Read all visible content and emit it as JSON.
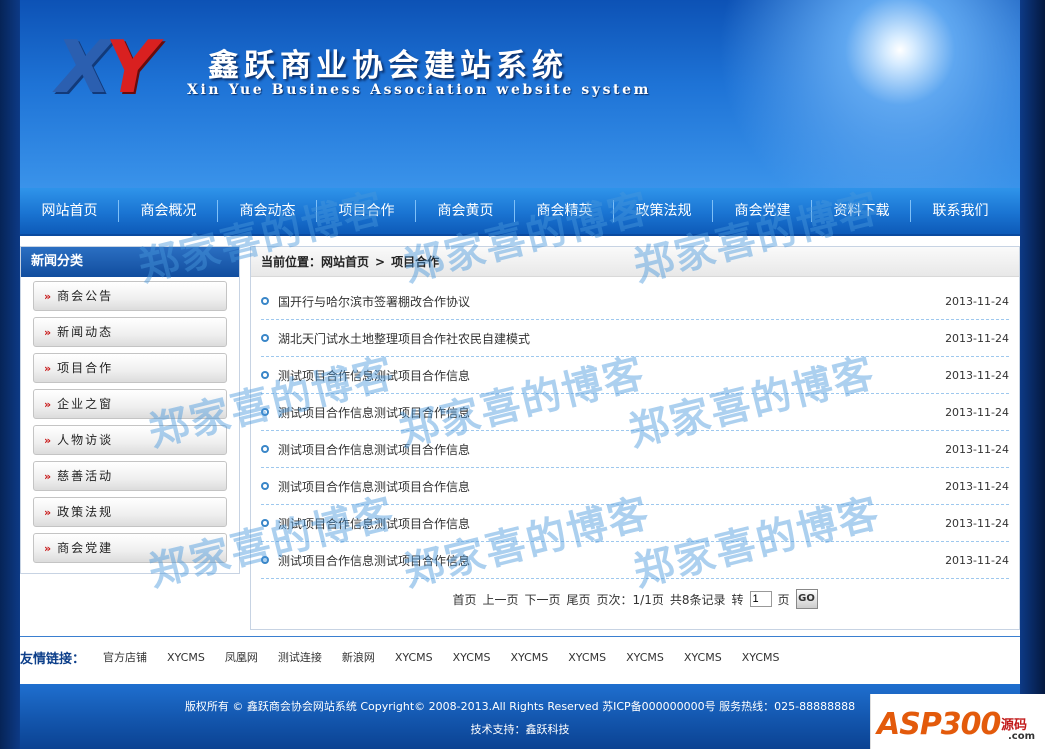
{
  "header": {
    "logo_x": "X",
    "logo_y": "Y",
    "title": "鑫跃商业协会建站系统",
    "subtitle": "Xin Yue Business Association website system"
  },
  "nav": [
    {
      "label": "网站首页"
    },
    {
      "label": "商会概况"
    },
    {
      "label": "商会动态"
    },
    {
      "label": "项目合作"
    },
    {
      "label": "商会黄页"
    },
    {
      "label": "商会精英"
    },
    {
      "label": "政策法规"
    },
    {
      "label": "商会党建"
    },
    {
      "label": "资料下载"
    },
    {
      "label": "联系我们"
    }
  ],
  "sidebar": {
    "title": "新闻分类",
    "arrow": "»",
    "items": [
      {
        "label": "商会公告"
      },
      {
        "label": "新闻动态"
      },
      {
        "label": "项目合作"
      },
      {
        "label": "企业之窗"
      },
      {
        "label": "人物访谈"
      },
      {
        "label": "慈善活动"
      },
      {
        "label": "政策法规"
      },
      {
        "label": "商会党建"
      }
    ]
  },
  "breadcrumb": {
    "prefix": "当前位置：",
    "home": "网站首页",
    "separator": ">",
    "current": "项目合作"
  },
  "news": [
    {
      "title": "国开行与哈尔滨市签署棚改合作协议",
      "date": "2013-11-24"
    },
    {
      "title": "湖北天门试水土地整理项目合作社农民自建模式",
      "date": "2013-11-24"
    },
    {
      "title": "测试项目合作信息测试项目合作信息",
      "date": "2013-11-24"
    },
    {
      "title": "测试项目合作信息测试项目合作信息",
      "date": "2013-11-24"
    },
    {
      "title": "测试项目合作信息测试项目合作信息",
      "date": "2013-11-24"
    },
    {
      "title": "测试项目合作信息测试项目合作信息",
      "date": "2013-11-24"
    },
    {
      "title": "测试项目合作信息测试项目合作信息",
      "date": "2013-11-24"
    },
    {
      "title": "测试项目合作信息测试项目合作信息",
      "date": "2013-11-24"
    }
  ],
  "pager": {
    "first": "首页",
    "prev": "上一页",
    "next": "下一页",
    "last": "尾页",
    "page_info": "页次：1/1页",
    "total": "共8条记录",
    "goto_label": "转",
    "page_value": "1",
    "page_unit": "页",
    "go_label": "GO"
  },
  "friend_links": {
    "label": "友情链接：",
    "items": [
      "官方店铺",
      "XYCMS",
      "凤凰网",
      "测试连接",
      "新浪网",
      "XYCMS",
      "XYCMS",
      "XYCMS",
      "XYCMS",
      "XYCMS",
      "XYCMS",
      "XYCMS"
    ]
  },
  "footer": {
    "copyright": "版权所有 © 鑫跃商会协会网站系统 Copyright© 2008-2013.All Rights Reserved 苏ICP备000000000号 服务热线：025-88888888",
    "support": "技术支持：鑫跃科技"
  },
  "watermark": "郑家喜的博客",
  "badge": {
    "main": "ASP300",
    "cn": "源码",
    "com": ".com"
  },
  "colors": {
    "nav_blue": "#1a74d2",
    "accent_red": "#c81818",
    "link_blue": "#0d3f8a"
  }
}
